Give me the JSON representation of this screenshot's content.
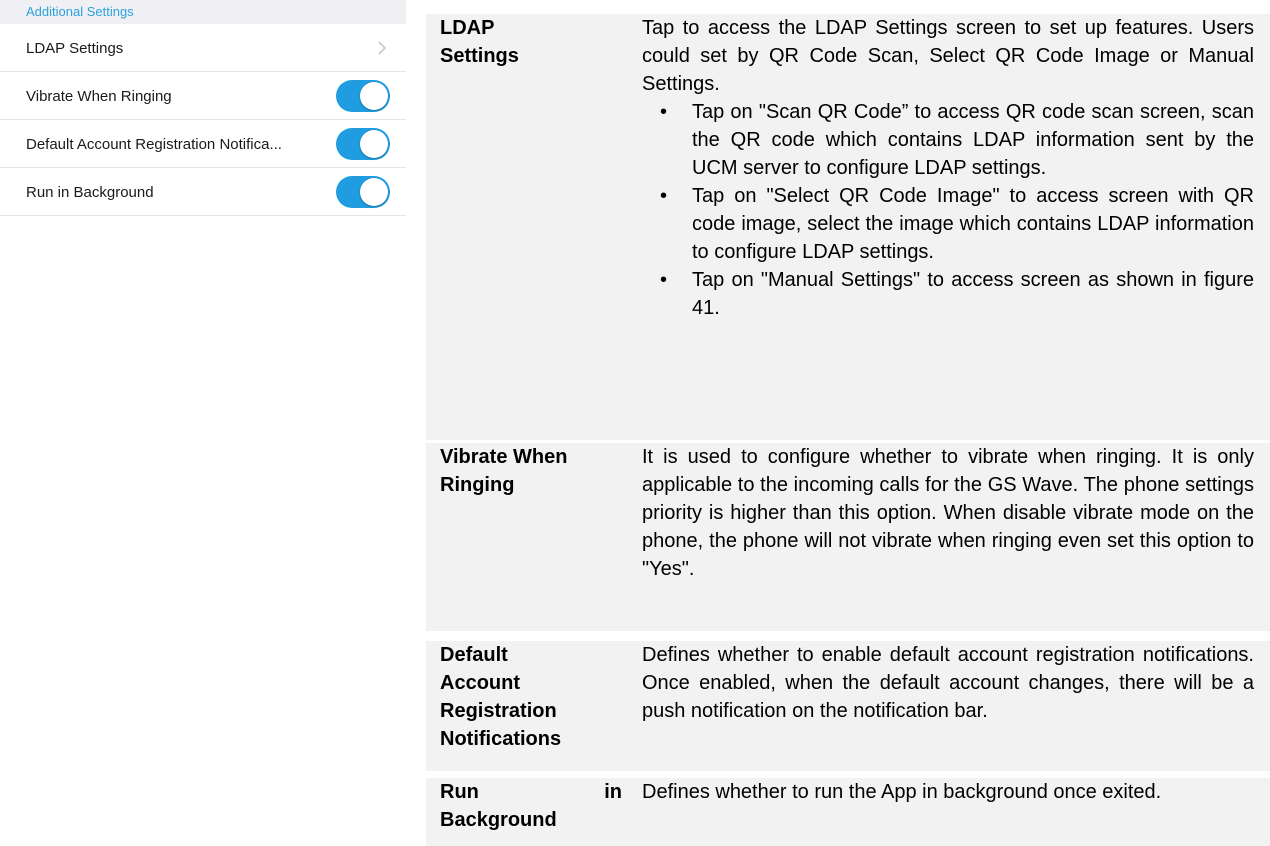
{
  "settings_panel": {
    "section_header": "Additional Settings",
    "rows": [
      {
        "label": "LDAP Settings",
        "control": "chevron"
      },
      {
        "label": "Vibrate When Ringing",
        "control": "toggle",
        "on": true
      },
      {
        "label": "Default Account Registration Notifica...",
        "control": "toggle",
        "on": true
      },
      {
        "label": "Run in Background",
        "control": "toggle",
        "on": true
      }
    ],
    "toggle_color": "#1f9de0",
    "header_color": "#2aa4dc"
  },
  "descriptions": [
    {
      "term": "LDAP Settings",
      "term_lines": [
        "LDAP",
        "Settings"
      ],
      "intro": "Tap to access the LDAP Settings screen to set up features. Users could set by QR Code Scan, Select QR Code Image or Manual Settings.",
      "bullets": [
        "Tap on \"Scan QR Code” to access QR code scan screen, scan the QR code which contains LDAP information sent by the UCM server to configure LDAP settings.",
        "Tap on \"Select QR Code Image\" to access screen with QR code image, select the image which contains LDAP information to configure LDAP settings.",
        "Tap on \"Manual Settings\" to access screen as shown in figure 41."
      ]
    },
    {
      "term": "Vibrate When Ringing",
      "term_lines": [
        "Vibrate When",
        "Ringing"
      ],
      "intro": "It is used to configure whether to vibrate when ringing. It is only applicable to the incoming calls for the GS Wave. The phone settings priority is higher than this option. When disable vibrate mode on the phone, the phone will not vibrate when ringing even set this option to \"Yes\"."
    },
    {
      "term": "Default Account Registration Notifications",
      "term_lines": [
        "Default",
        "Account",
        "Registration",
        "Notifications"
      ],
      "intro": "Defines whether to enable default account registration notifications. Once enabled, when the default account changes, there will be a push notification on the notification bar."
    },
    {
      "term": "Run in Background",
      "term_lines": [
        "Run in",
        "Background"
      ],
      "intro": "Defines whether to run the App in background once exited."
    }
  ]
}
